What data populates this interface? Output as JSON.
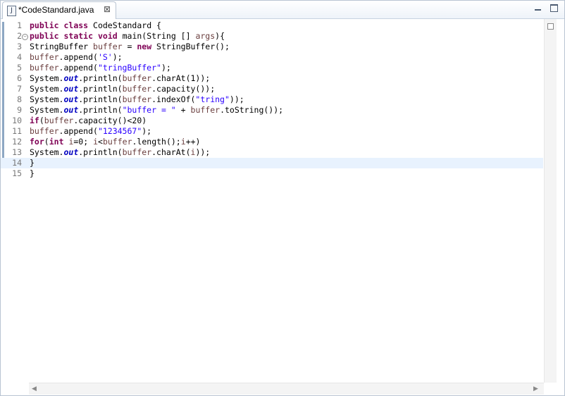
{
  "tab": {
    "title": "*CodeStandard.java",
    "icon_letter": "J",
    "close_glyph": "⊠"
  },
  "window_buttons": {
    "minimize": "minimize-icon",
    "maximize": "maximize-icon"
  },
  "editor": {
    "current_line": 14,
    "lines": [
      {
        "num": "1",
        "tokens": [
          [
            "kw",
            "public"
          ],
          [
            "t",
            " "
          ],
          [
            "kw",
            "class"
          ],
          [
            "t",
            " CodeStandard {"
          ]
        ]
      },
      {
        "num": "2",
        "fold": true,
        "tokens": [
          [
            "kw",
            "public"
          ],
          [
            "t",
            " "
          ],
          [
            "kw",
            "static"
          ],
          [
            "t",
            " "
          ],
          [
            "kw",
            "void"
          ],
          [
            "t",
            " main(String [] "
          ],
          [
            "var",
            "args"
          ],
          [
            "t",
            "){"
          ]
        ]
      },
      {
        "num": "3",
        "tokens": [
          [
            "t",
            "StringBuffer "
          ],
          [
            "var",
            "buffer"
          ],
          [
            "t",
            " = "
          ],
          [
            "kw",
            "new"
          ],
          [
            "t",
            " StringBuffer();"
          ]
        ]
      },
      {
        "num": "4",
        "tokens": [
          [
            "var",
            "buffer"
          ],
          [
            "t",
            ".append("
          ],
          [
            "st",
            "'S'"
          ],
          [
            "t",
            ");"
          ]
        ]
      },
      {
        "num": "5",
        "tokens": [
          [
            "var",
            "buffer"
          ],
          [
            "t",
            ".append("
          ],
          [
            "st",
            "\"tringBuffer\""
          ],
          [
            "t",
            ");"
          ]
        ]
      },
      {
        "num": "6",
        "tokens": [
          [
            "t",
            "System."
          ],
          [
            "fld",
            "out"
          ],
          [
            "t",
            ".println("
          ],
          [
            "var",
            "buffer"
          ],
          [
            "t",
            ".charAt(1));"
          ]
        ]
      },
      {
        "num": "7",
        "tokens": [
          [
            "t",
            "System."
          ],
          [
            "fld",
            "out"
          ],
          [
            "t",
            ".println("
          ],
          [
            "var",
            "buffer"
          ],
          [
            "t",
            ".capacity());"
          ]
        ]
      },
      {
        "num": "8",
        "tokens": [
          [
            "t",
            "System."
          ],
          [
            "fld",
            "out"
          ],
          [
            "t",
            ".println("
          ],
          [
            "var",
            "buffer"
          ],
          [
            "t",
            ".indexOf("
          ],
          [
            "st",
            "\"tring\""
          ],
          [
            "t",
            "));"
          ]
        ]
      },
      {
        "num": "9",
        "tokens": [
          [
            "t",
            "System."
          ],
          [
            "fld",
            "out"
          ],
          [
            "t",
            ".println("
          ],
          [
            "st",
            "\"buffer = \""
          ],
          [
            "t",
            " + "
          ],
          [
            "var",
            "buffer"
          ],
          [
            "t",
            ".toString());"
          ]
        ]
      },
      {
        "num": "10",
        "tokens": [
          [
            "kw",
            "if"
          ],
          [
            "t",
            "("
          ],
          [
            "var",
            "buffer"
          ],
          [
            "t",
            ".capacity()<20)"
          ]
        ]
      },
      {
        "num": "11",
        "tokens": [
          [
            "var",
            "buffer"
          ],
          [
            "t",
            ".append("
          ],
          [
            "st",
            "\"1234567\""
          ],
          [
            "t",
            ");"
          ]
        ]
      },
      {
        "num": "12",
        "tokens": [
          [
            "kw",
            "for"
          ],
          [
            "t",
            "("
          ],
          [
            "kw",
            "int"
          ],
          [
            "t",
            " "
          ],
          [
            "var",
            "i"
          ],
          [
            "t",
            "=0; "
          ],
          [
            "var",
            "i"
          ],
          [
            "t",
            "<"
          ],
          [
            "var",
            "buffer"
          ],
          [
            "t",
            ".length();"
          ],
          [
            "var",
            "i"
          ],
          [
            "t",
            "++)"
          ]
        ]
      },
      {
        "num": "13",
        "tokens": [
          [
            "t",
            "System."
          ],
          [
            "fld",
            "out"
          ],
          [
            "t",
            ".println("
          ],
          [
            "var",
            "buffer"
          ],
          [
            "t",
            ".charAt("
          ],
          [
            "var",
            "i"
          ],
          [
            "t",
            "));"
          ]
        ]
      },
      {
        "num": "14",
        "tokens": [
          [
            "t",
            "}"
          ]
        ]
      },
      {
        "num": "15",
        "tokens": [
          [
            "t",
            "}"
          ]
        ]
      }
    ]
  }
}
